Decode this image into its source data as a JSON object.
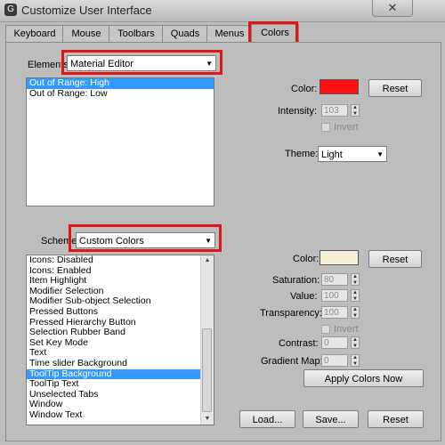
{
  "window": {
    "title": "Customize User Interface",
    "close_label": "✕"
  },
  "tabs": [
    {
      "label": "Keyboard"
    },
    {
      "label": "Mouse"
    },
    {
      "label": "Toolbars"
    },
    {
      "label": "Quads"
    },
    {
      "label": "Menus"
    },
    {
      "label": "Colors",
      "active": true
    }
  ],
  "elements": {
    "label": "Elements:",
    "value": "Material Editor"
  },
  "elements_list": [
    "Out of Range: High",
    "Out of Range: Low"
  ],
  "elements_list_selected": 0,
  "top_color": {
    "label": "Color:",
    "swatch": "#ff1010",
    "reset_label": "Reset"
  },
  "intensity": {
    "label": "Intensity:",
    "value": "103"
  },
  "invert_top": {
    "label": "Invert",
    "checked": false
  },
  "theme": {
    "label": "Theme:",
    "value": "Light"
  },
  "scheme": {
    "label": "Scheme:",
    "value": "Custom Colors"
  },
  "scheme_list": [
    "Icons: Disabled",
    "Icons: Enabled",
    "Item Highlight",
    "Modifier Selection",
    "Modifier Sub-object Selection",
    "Pressed Buttons",
    "Pressed Hierarchy Button",
    "Selection Rubber Band",
    "Set Key Mode",
    "Text",
    "Time slider Background",
    "ToolTip Background",
    "ToolTip Text",
    "Unselected Tabs",
    "Window",
    "Window Text"
  ],
  "scheme_list_selected": 11,
  "bottom_color": {
    "label": "Color:",
    "swatch": "#f6f1d6",
    "reset_label": "Reset"
  },
  "saturation": {
    "label": "Saturation:",
    "value": "80"
  },
  "value": {
    "label": "Value:",
    "value": "100"
  },
  "transparency": {
    "label": "Transparency:",
    "value": "100"
  },
  "invert_bottom": {
    "label": "Invert",
    "checked": false
  },
  "contrast": {
    "label": "Contrast:",
    "value": "0"
  },
  "gradient_map": {
    "label": "Gradient Map:",
    "value": "0"
  },
  "apply_label": "Apply Colors Now",
  "footer": {
    "load": "Load...",
    "save": "Save...",
    "reset": "Reset"
  },
  "highlight_color": "#e01515"
}
